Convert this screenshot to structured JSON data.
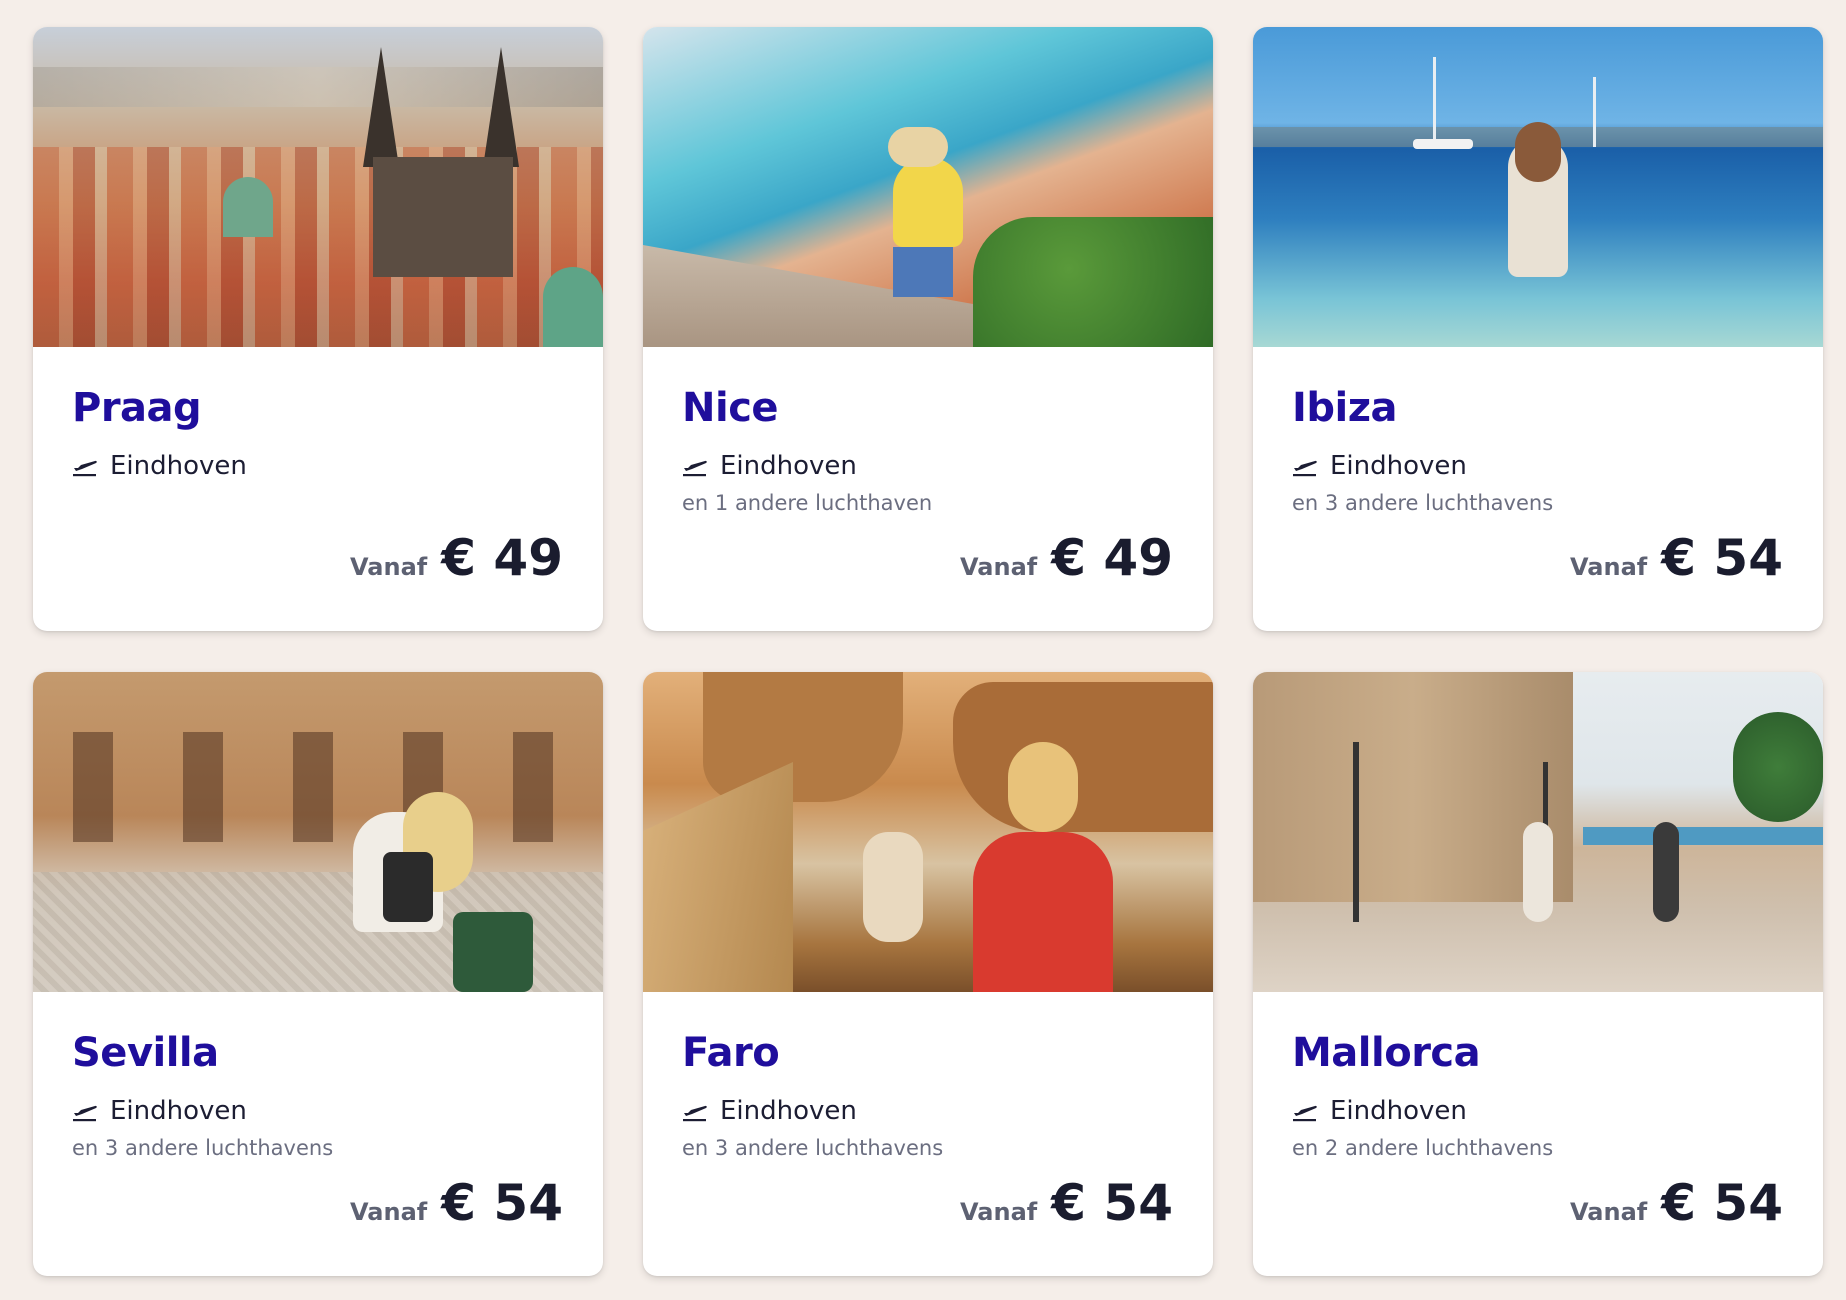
{
  "cards": [
    {
      "destination": "Praag",
      "airport": "Eindhoven",
      "extra": "",
      "from_label": "Vanaf",
      "price": "€ 49",
      "icon": "plane-departure-icon",
      "image": "prague-old-town-rooftops"
    },
    {
      "destination": "Nice",
      "airport": "Eindhoven",
      "extra": "en 1 andere luchthaven",
      "from_label": "Vanaf",
      "price": "€ 49",
      "icon": "plane-departure-icon",
      "image": "nice-coast-balcony"
    },
    {
      "destination": "Ibiza",
      "airport": "Eindhoven",
      "extra": "en 3 andere luchthavens",
      "from_label": "Vanaf",
      "price": "€ 54",
      "icon": "plane-departure-icon",
      "image": "ibiza-woman-in-sea"
    },
    {
      "destination": "Sevilla",
      "airport": "Eindhoven",
      "extra": "en 3 andere luchthavens",
      "from_label": "Vanaf",
      "price": "€ 54",
      "icon": "plane-departure-icon",
      "image": "sevilla-plaza-bicycle"
    },
    {
      "destination": "Faro",
      "airport": "Eindhoven",
      "extra": "en 3 andere luchthavens",
      "from_label": "Vanaf",
      "price": "€ 54",
      "icon": "plane-departure-icon",
      "image": "faro-cliff-stairs"
    },
    {
      "destination": "Mallorca",
      "airport": "Eindhoven",
      "extra": "en 2 andere luchthavens",
      "from_label": "Vanaf",
      "price": "€ 54",
      "icon": "plane-departure-icon",
      "image": "mallorca-promenade"
    }
  ],
  "colors": {
    "page_background": "#f5eee9",
    "title": "#1f0e9c",
    "price": "#1a1c2e",
    "secondary_text": "#6b6e80"
  }
}
